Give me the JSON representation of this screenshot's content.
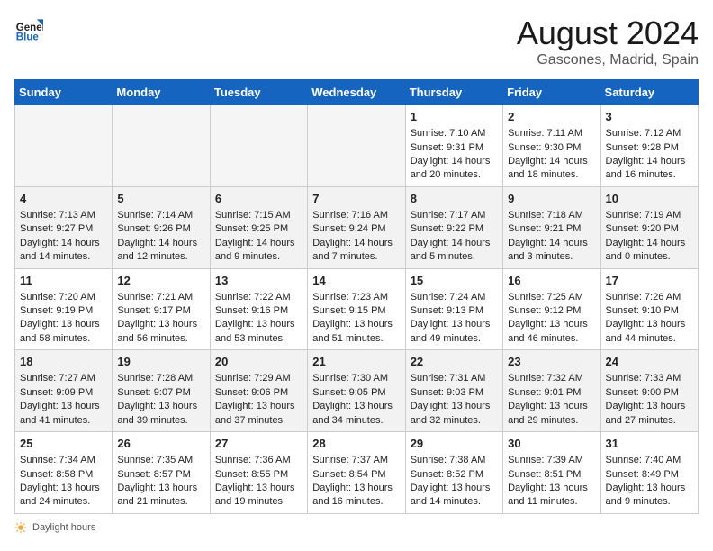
{
  "header": {
    "logo_line1": "General",
    "logo_line2": "Blue",
    "month_title": "August 2024",
    "location": "Gascones, Madrid, Spain"
  },
  "weekdays": [
    "Sunday",
    "Monday",
    "Tuesday",
    "Wednesday",
    "Thursday",
    "Friday",
    "Saturday"
  ],
  "weeks": [
    [
      {
        "day": "",
        "empty": true
      },
      {
        "day": "",
        "empty": true
      },
      {
        "day": "",
        "empty": true
      },
      {
        "day": "",
        "empty": true
      },
      {
        "day": "1",
        "sunrise": "Sunrise: 7:10 AM",
        "sunset": "Sunset: 9:31 PM",
        "daylight": "Daylight: 14 hours and 20 minutes."
      },
      {
        "day": "2",
        "sunrise": "Sunrise: 7:11 AM",
        "sunset": "Sunset: 9:30 PM",
        "daylight": "Daylight: 14 hours and 18 minutes."
      },
      {
        "day": "3",
        "sunrise": "Sunrise: 7:12 AM",
        "sunset": "Sunset: 9:28 PM",
        "daylight": "Daylight: 14 hours and 16 minutes."
      }
    ],
    [
      {
        "day": "4",
        "sunrise": "Sunrise: 7:13 AM",
        "sunset": "Sunset: 9:27 PM",
        "daylight": "Daylight: 14 hours and 14 minutes."
      },
      {
        "day": "5",
        "sunrise": "Sunrise: 7:14 AM",
        "sunset": "Sunset: 9:26 PM",
        "daylight": "Daylight: 14 hours and 12 minutes."
      },
      {
        "day": "6",
        "sunrise": "Sunrise: 7:15 AM",
        "sunset": "Sunset: 9:25 PM",
        "daylight": "Daylight: 14 hours and 9 minutes."
      },
      {
        "day": "7",
        "sunrise": "Sunrise: 7:16 AM",
        "sunset": "Sunset: 9:24 PM",
        "daylight": "Daylight: 14 hours and 7 minutes."
      },
      {
        "day": "8",
        "sunrise": "Sunrise: 7:17 AM",
        "sunset": "Sunset: 9:22 PM",
        "daylight": "Daylight: 14 hours and 5 minutes."
      },
      {
        "day": "9",
        "sunrise": "Sunrise: 7:18 AM",
        "sunset": "Sunset: 9:21 PM",
        "daylight": "Daylight: 14 hours and 3 minutes."
      },
      {
        "day": "10",
        "sunrise": "Sunrise: 7:19 AM",
        "sunset": "Sunset: 9:20 PM",
        "daylight": "Daylight: 14 hours and 0 minutes."
      }
    ],
    [
      {
        "day": "11",
        "sunrise": "Sunrise: 7:20 AM",
        "sunset": "Sunset: 9:19 PM",
        "daylight": "Daylight: 13 hours and 58 minutes."
      },
      {
        "day": "12",
        "sunrise": "Sunrise: 7:21 AM",
        "sunset": "Sunset: 9:17 PM",
        "daylight": "Daylight: 13 hours and 56 minutes."
      },
      {
        "day": "13",
        "sunrise": "Sunrise: 7:22 AM",
        "sunset": "Sunset: 9:16 PM",
        "daylight": "Daylight: 13 hours and 53 minutes."
      },
      {
        "day": "14",
        "sunrise": "Sunrise: 7:23 AM",
        "sunset": "Sunset: 9:15 PM",
        "daylight": "Daylight: 13 hours and 51 minutes."
      },
      {
        "day": "15",
        "sunrise": "Sunrise: 7:24 AM",
        "sunset": "Sunset: 9:13 PM",
        "daylight": "Daylight: 13 hours and 49 minutes."
      },
      {
        "day": "16",
        "sunrise": "Sunrise: 7:25 AM",
        "sunset": "Sunset: 9:12 PM",
        "daylight": "Daylight: 13 hours and 46 minutes."
      },
      {
        "day": "17",
        "sunrise": "Sunrise: 7:26 AM",
        "sunset": "Sunset: 9:10 PM",
        "daylight": "Daylight: 13 hours and 44 minutes."
      }
    ],
    [
      {
        "day": "18",
        "sunrise": "Sunrise: 7:27 AM",
        "sunset": "Sunset: 9:09 PM",
        "daylight": "Daylight: 13 hours and 41 minutes."
      },
      {
        "day": "19",
        "sunrise": "Sunrise: 7:28 AM",
        "sunset": "Sunset: 9:07 PM",
        "daylight": "Daylight: 13 hours and 39 minutes."
      },
      {
        "day": "20",
        "sunrise": "Sunrise: 7:29 AM",
        "sunset": "Sunset: 9:06 PM",
        "daylight": "Daylight: 13 hours and 37 minutes."
      },
      {
        "day": "21",
        "sunrise": "Sunrise: 7:30 AM",
        "sunset": "Sunset: 9:05 PM",
        "daylight": "Daylight: 13 hours and 34 minutes."
      },
      {
        "day": "22",
        "sunrise": "Sunrise: 7:31 AM",
        "sunset": "Sunset: 9:03 PM",
        "daylight": "Daylight: 13 hours and 32 minutes."
      },
      {
        "day": "23",
        "sunrise": "Sunrise: 7:32 AM",
        "sunset": "Sunset: 9:01 PM",
        "daylight": "Daylight: 13 hours and 29 minutes."
      },
      {
        "day": "24",
        "sunrise": "Sunrise: 7:33 AM",
        "sunset": "Sunset: 9:00 PM",
        "daylight": "Daylight: 13 hours and 27 minutes."
      }
    ],
    [
      {
        "day": "25",
        "sunrise": "Sunrise: 7:34 AM",
        "sunset": "Sunset: 8:58 PM",
        "daylight": "Daylight: 13 hours and 24 minutes."
      },
      {
        "day": "26",
        "sunrise": "Sunrise: 7:35 AM",
        "sunset": "Sunset: 8:57 PM",
        "daylight": "Daylight: 13 hours and 21 minutes."
      },
      {
        "day": "27",
        "sunrise": "Sunrise: 7:36 AM",
        "sunset": "Sunset: 8:55 PM",
        "daylight": "Daylight: 13 hours and 19 minutes."
      },
      {
        "day": "28",
        "sunrise": "Sunrise: 7:37 AM",
        "sunset": "Sunset: 8:54 PM",
        "daylight": "Daylight: 13 hours and 16 minutes."
      },
      {
        "day": "29",
        "sunrise": "Sunrise: 7:38 AM",
        "sunset": "Sunset: 8:52 PM",
        "daylight": "Daylight: 13 hours and 14 minutes."
      },
      {
        "day": "30",
        "sunrise": "Sunrise: 7:39 AM",
        "sunset": "Sunset: 8:51 PM",
        "daylight": "Daylight: 13 hours and 11 minutes."
      },
      {
        "day": "31",
        "sunrise": "Sunrise: 7:40 AM",
        "sunset": "Sunset: 8:49 PM",
        "daylight": "Daylight: 13 hours and 9 minutes."
      }
    ]
  ],
  "footer": {
    "daylight_hours_label": "Daylight hours"
  }
}
